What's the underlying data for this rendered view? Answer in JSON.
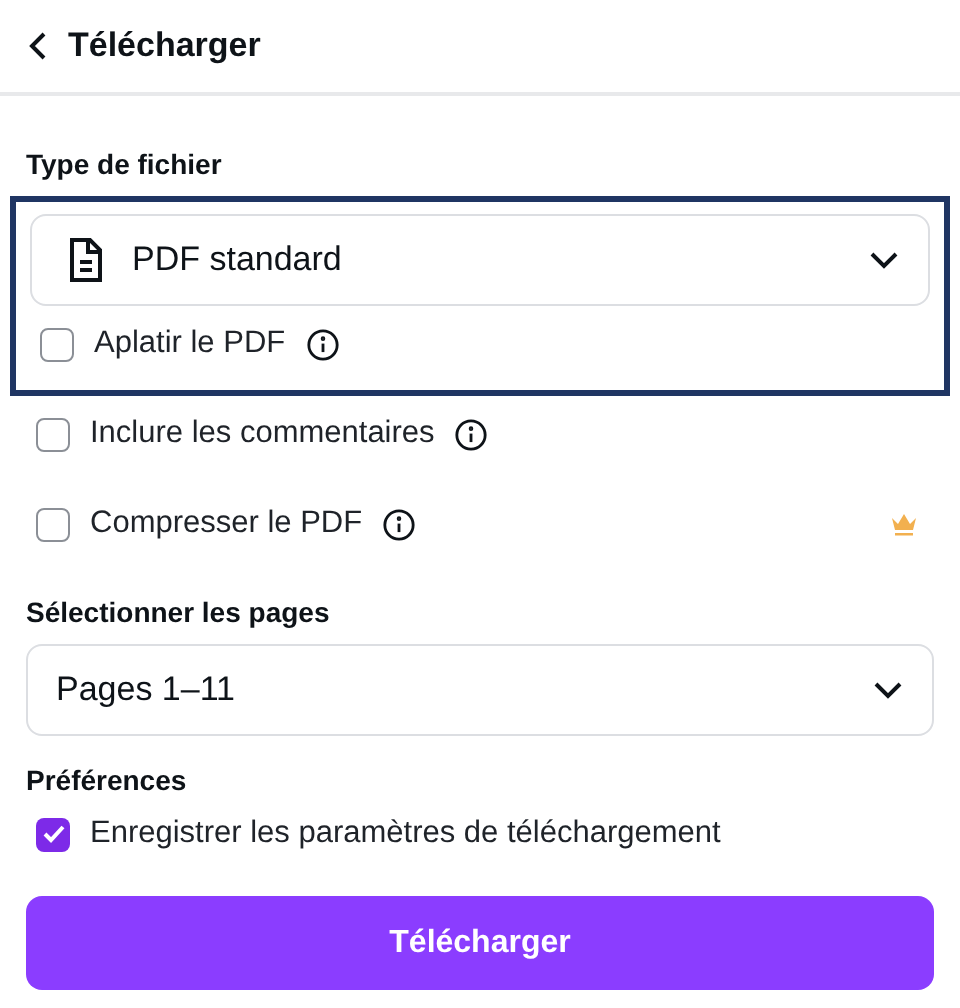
{
  "header": {
    "title": "Télécharger"
  },
  "file_type": {
    "label": "Type de fichier",
    "value": "PDF standard",
    "highlighted": true
  },
  "options": [
    {
      "label": "Aplatir le PDF",
      "checked": false,
      "info": true,
      "premium": false
    },
    {
      "label": "Inclure les commentaires",
      "checked": false,
      "info": true,
      "premium": false
    },
    {
      "label": "Compresser le PDF",
      "checked": false,
      "info": true,
      "premium": true
    }
  ],
  "pages": {
    "label": "Sélectionner les pages",
    "value": "Pages 1–11"
  },
  "preferences": {
    "label": "Préférences",
    "option": {
      "label": "Enregistrer les paramètres de téléchargement",
      "checked": true
    }
  },
  "button": "Télécharger"
}
